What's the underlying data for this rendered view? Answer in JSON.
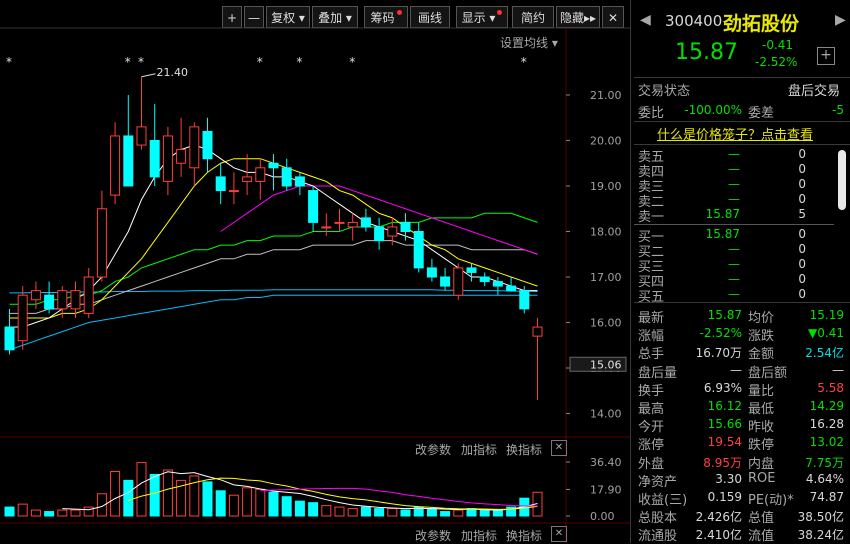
{
  "toolbar": {
    "plus": "+",
    "minus": "—",
    "fuquan": "复权",
    "diejia": "叠加",
    "chouma": "筹码",
    "huaxian": "画线",
    "xianshi": "显示",
    "jianyue": "简约",
    "yincang": "隐藏"
  },
  "chart": {
    "ma_settings": "设置均线",
    "peak_label": "21.40",
    "price_axis": [
      "21.00",
      "20.00",
      "19.00",
      "18.00",
      "17.00",
      "16.00",
      "15.00",
      "14.00"
    ],
    "current_price_tag": "15.06",
    "volume_axis": [
      "36.40",
      "17.90",
      "0.00"
    ],
    "vol_ctrl": {
      "param": "改参数",
      "add": "加指标",
      "swap": "换指标",
      "close": "✕"
    },
    "bottom_ctrl": {
      "param": "改参数",
      "add": "加指标",
      "swap": "换指标",
      "close": "✕"
    },
    "star": "*"
  },
  "quote": {
    "code": "300400",
    "name": "劲拓股份",
    "price": "15.87",
    "change": "-0.41",
    "change_pct": "-2.52%",
    "add": "+",
    "trade_status_label": "交易状态",
    "trade_status": "盘后交易",
    "weibi_label": "委比",
    "weibi": "-100.00%",
    "weicha_label": "委差",
    "weicha": "-5",
    "link": "什么是价格笼子？点击查看"
  },
  "orderbook": {
    "sell": [
      {
        "label": "卖五",
        "price": "—",
        "vol": "0"
      },
      {
        "label": "卖四",
        "price": "—",
        "vol": "0"
      },
      {
        "label": "卖三",
        "price": "—",
        "vol": "0"
      },
      {
        "label": "卖二",
        "price": "—",
        "vol": "0"
      },
      {
        "label": "卖一",
        "price": "15.87",
        "vol": "5"
      }
    ],
    "buy": [
      {
        "label": "买一",
        "price": "15.87",
        "vol": "0"
      },
      {
        "label": "买二",
        "price": "—",
        "vol": "0"
      },
      {
        "label": "买三",
        "price": "—",
        "vol": "0"
      },
      {
        "label": "买四",
        "price": "—",
        "vol": "0"
      },
      {
        "label": "买五",
        "price": "—",
        "vol": "0"
      }
    ]
  },
  "stats": [
    {
      "l1": "最新",
      "v1": "15.87",
      "c1": "g",
      "l2": "均价",
      "v2": "15.19",
      "c2": "g"
    },
    {
      "l1": "涨幅",
      "v1": "-2.52%",
      "c1": "g",
      "l2": "涨跌",
      "v2": "▼0.41",
      "c2": "g"
    },
    {
      "l1": "总手",
      "v1": "16.70万",
      "c1": "w",
      "l2": "金额",
      "v2": "2.54亿",
      "c2": "c"
    },
    {
      "l1": "盘后量",
      "v1": "—",
      "c1": "w",
      "l2": "盘后额",
      "v2": "—",
      "c2": "w"
    },
    {
      "l1": "换手",
      "v1": "6.93%",
      "c1": "w",
      "l2": "量比",
      "v2": "5.58",
      "c2": "r"
    },
    {
      "l1": "最高",
      "v1": "16.12",
      "c1": "g",
      "l2": "最低",
      "v2": "14.29",
      "c2": "g"
    },
    {
      "l1": "今开",
      "v1": "15.66",
      "c1": "g",
      "l2": "昨收",
      "v2": "16.28",
      "c2": "w"
    },
    {
      "l1": "涨停",
      "v1": "19.54",
      "c1": "r",
      "l2": "跌停",
      "v2": "13.02",
      "c2": "g"
    },
    {
      "l1": "外盘",
      "v1": "8.95万",
      "c1": "r",
      "l2": "内盘",
      "v2": "7.75万",
      "c2": "g"
    },
    {
      "l1": "净资产",
      "v1": "3.30",
      "c1": "w",
      "l2": "ROE",
      "v2": "4.64%",
      "c2": "w"
    },
    {
      "l1": "收益(三)",
      "v1": "0.159",
      "c1": "w",
      "l2": "PE(动)*",
      "v2": "74.87",
      "c2": "w"
    },
    {
      "l1": "总股本",
      "v1": "2.426亿",
      "c1": "w",
      "l2": "总值",
      "v2": "38.50亿",
      "c2": "w"
    },
    {
      "l1": "流通股",
      "v1": "2.410亿",
      "c1": "w",
      "l2": "流值",
      "v2": "38.24亿",
      "c2": "w"
    }
  ],
  "colors": {
    "up": "#ff3c3c",
    "down": "#00ffff",
    "ma5": "#ffffff",
    "ma10": "#ffff00",
    "ma20": "#ff00ff",
    "ma60": "#00ff00",
    "ma120": "#c0c0c0",
    "ma250": "#00bfff"
  },
  "chart_data": {
    "type": "candlestick",
    "candles": [
      {
        "o": 15.9,
        "h": 16.3,
        "l": 15.3,
        "c": 15.4
      },
      {
        "o": 15.6,
        "h": 16.8,
        "l": 15.4,
        "c": 16.6
      },
      {
        "o": 16.5,
        "h": 16.9,
        "l": 16.3,
        "c": 16.7
      },
      {
        "o": 16.6,
        "h": 16.9,
        "l": 16.2,
        "c": 16.3
      },
      {
        "o": 16.3,
        "h": 16.8,
        "l": 16.1,
        "c": 16.7
      },
      {
        "o": 16.3,
        "h": 16.9,
        "l": 16.1,
        "c": 16.7
      },
      {
        "o": 16.2,
        "h": 17.2,
        "l": 16.1,
        "c": 17.0
      },
      {
        "o": 17.0,
        "h": 18.9,
        "l": 16.9,
        "c": 18.5
      },
      {
        "o": 18.8,
        "h": 20.4,
        "l": 18.6,
        "c": 20.1
      },
      {
        "o": 20.1,
        "h": 21.0,
        "l": 19.5,
        "c": 19.0
      },
      {
        "o": 19.9,
        "h": 21.4,
        "l": 19.8,
        "c": 20.3
      },
      {
        "o": 20.0,
        "h": 20.8,
        "l": 19.0,
        "c": 19.2
      },
      {
        "o": 19.1,
        "h": 20.3,
        "l": 18.8,
        "c": 20.1
      },
      {
        "o": 19.5,
        "h": 20.5,
        "l": 19.2,
        "c": 19.8
      },
      {
        "o": 19.4,
        "h": 20.4,
        "l": 19.0,
        "c": 20.3
      },
      {
        "o": 20.2,
        "h": 20.5,
        "l": 19.3,
        "c": 19.6
      },
      {
        "o": 19.2,
        "h": 19.5,
        "l": 18.6,
        "c": 18.9
      },
      {
        "o": 18.9,
        "h": 19.3,
        "l": 18.6,
        "c": 18.9
      },
      {
        "o": 19.1,
        "h": 19.7,
        "l": 18.8,
        "c": 19.2
      },
      {
        "o": 19.1,
        "h": 19.6,
        "l": 18.7,
        "c": 19.4
      },
      {
        "o": 19.5,
        "h": 19.7,
        "l": 18.9,
        "c": 19.4
      },
      {
        "o": 19.4,
        "h": 19.6,
        "l": 18.9,
        "c": 19.0
      },
      {
        "o": 19.2,
        "h": 19.3,
        "l": 18.8,
        "c": 19.0
      },
      {
        "o": 18.9,
        "h": 19.0,
        "l": 18.0,
        "c": 18.2
      },
      {
        "o": 18.1,
        "h": 18.4,
        "l": 17.9,
        "c": 18.1
      },
      {
        "o": 18.2,
        "h": 18.5,
        "l": 18.0,
        "c": 18.2
      },
      {
        "o": 18.1,
        "h": 18.4,
        "l": 17.8,
        "c": 18.2
      },
      {
        "o": 18.3,
        "h": 18.5,
        "l": 18.0,
        "c": 18.1
      },
      {
        "o": 18.1,
        "h": 18.3,
        "l": 17.6,
        "c": 17.8
      },
      {
        "o": 17.9,
        "h": 18.3,
        "l": 17.7,
        "c": 18.1
      },
      {
        "o": 18.2,
        "h": 18.4,
        "l": 17.8,
        "c": 18.0
      },
      {
        "o": 18.0,
        "h": 18.2,
        "l": 17.1,
        "c": 17.2
      },
      {
        "o": 17.2,
        "h": 17.4,
        "l": 16.9,
        "c": 17.0
      },
      {
        "o": 17.0,
        "h": 17.2,
        "l": 16.7,
        "c": 16.8
      },
      {
        "o": 16.6,
        "h": 17.3,
        "l": 16.5,
        "c": 17.2
      },
      {
        "o": 17.2,
        "h": 17.3,
        "l": 16.9,
        "c": 17.1
      },
      {
        "o": 17.0,
        "h": 17.1,
        "l": 16.8,
        "c": 16.9
      },
      {
        "o": 16.9,
        "h": 17.0,
        "l": 16.6,
        "c": 16.8
      },
      {
        "o": 16.8,
        "h": 17.0,
        "l": 16.7,
        "c": 16.7
      },
      {
        "o": 16.7,
        "h": 16.8,
        "l": 16.2,
        "c": 16.3
      },
      {
        "o": 15.7,
        "h": 16.1,
        "l": 14.3,
        "c": 15.9
      }
    ],
    "volume": [
      6,
      8,
      4,
      3,
      4,
      4,
      6,
      15,
      30,
      24,
      36,
      28,
      31,
      24,
      27,
      23,
      17,
      14,
      19,
      18,
      16,
      13,
      10,
      9,
      7,
      6,
      5,
      6,
      5,
      5,
      4,
      6,
      5,
      3,
      4,
      5,
      4,
      4,
      6,
      12,
      16
    ],
    "ma": {
      "ma5": [
        15.9,
        15.9,
        16.0,
        16.1,
        16.3,
        16.5,
        16.7,
        17.0,
        17.5,
        18.0,
        18.7,
        19.2,
        19.6,
        19.8,
        19.9,
        19.8,
        19.6,
        19.4,
        19.3,
        19.3,
        19.2,
        19.2,
        19.1,
        19.0,
        18.8,
        18.6,
        18.4,
        18.2,
        18.1,
        18.0,
        17.9,
        17.8,
        17.6,
        17.4,
        17.2,
        17.0,
        17.0,
        16.9,
        16.8,
        16.7,
        16.7
      ],
      "ma10": [
        16.1,
        16.1,
        16.1,
        16.1,
        16.2,
        16.2,
        16.3,
        16.5,
        16.8,
        17.1,
        17.4,
        17.8,
        18.2,
        18.6,
        19.0,
        19.3,
        19.5,
        19.6,
        19.6,
        19.6,
        19.5,
        19.4,
        19.3,
        19.2,
        19.1,
        18.9,
        18.8,
        18.6,
        18.4,
        18.3,
        18.1,
        17.9,
        17.7,
        17.6,
        17.4,
        17.3,
        17.2,
        17.1,
        17.0,
        16.9,
        16.8
      ],
      "ma20": [
        null,
        null,
        null,
        null,
        null,
        null,
        null,
        null,
        null,
        null,
        null,
        null,
        null,
        null,
        null,
        null,
        18.0,
        18.2,
        18.4,
        18.6,
        18.8,
        18.9,
        19.0,
        19.0,
        19.0,
        19.0,
        18.9,
        18.8,
        18.7,
        18.6,
        18.5,
        18.4,
        18.3,
        18.2,
        18.1,
        18.0,
        17.9,
        17.8,
        17.7,
        17.6,
        17.5
      ],
      "ma60": [
        16.4,
        16.4,
        16.4,
        16.5,
        16.5,
        16.6,
        16.6,
        16.7,
        16.9,
        17.0,
        17.2,
        17.3,
        17.4,
        17.5,
        17.6,
        17.6,
        17.7,
        17.7,
        17.8,
        17.8,
        17.9,
        17.9,
        17.9,
        18.0,
        18.0,
        18.0,
        18.1,
        18.1,
        18.1,
        18.2,
        18.2,
        18.2,
        18.3,
        18.3,
        18.3,
        18.3,
        18.4,
        18.4,
        18.4,
        18.3,
        18.2
      ],
      "ma120": [
        16.2,
        16.2,
        16.2,
        16.3,
        16.3,
        16.4,
        16.4,
        16.5,
        16.6,
        16.7,
        16.8,
        16.9,
        17.0,
        17.1,
        17.2,
        17.3,
        17.4,
        17.4,
        17.5,
        17.5,
        17.6,
        17.6,
        17.6,
        17.7,
        17.7,
        17.7,
        17.7,
        17.8,
        17.8,
        17.8,
        17.7,
        17.7,
        17.7,
        17.7,
        17.7,
        17.6,
        17.6,
        17.6,
        17.6,
        17.6,
        17.5
      ],
      "ma250": [
        16.65,
        16.65,
        16.66,
        16.66,
        16.66,
        16.67,
        16.67,
        16.67,
        16.68,
        16.68,
        16.68,
        16.69,
        16.69,
        16.69,
        16.7,
        16.7,
        16.7,
        16.71,
        16.71,
        16.71,
        16.72,
        16.72,
        16.72,
        16.72,
        16.72,
        16.72,
        16.72,
        16.72,
        16.72,
        16.72,
        16.72,
        16.72,
        16.72,
        16.71,
        16.71,
        16.7,
        16.7,
        16.7,
        16.69,
        16.69,
        16.68
      ],
      "ma_b": [
        15.4,
        15.5,
        15.6,
        15.7,
        15.8,
        15.9,
        16.0,
        16.05,
        16.1,
        16.15,
        16.2,
        16.25,
        16.3,
        16.35,
        16.4,
        16.45,
        16.5,
        16.5,
        16.55,
        16.55,
        16.6,
        16.6,
        16.6,
        16.6,
        16.6,
        16.6,
        16.6,
        16.6,
        16.6,
        16.6,
        16.6,
        16.6,
        16.6,
        16.6,
        16.6,
        16.6,
        16.6,
        16.6,
        16.6,
        16.6,
        16.6
      ]
    }
  }
}
